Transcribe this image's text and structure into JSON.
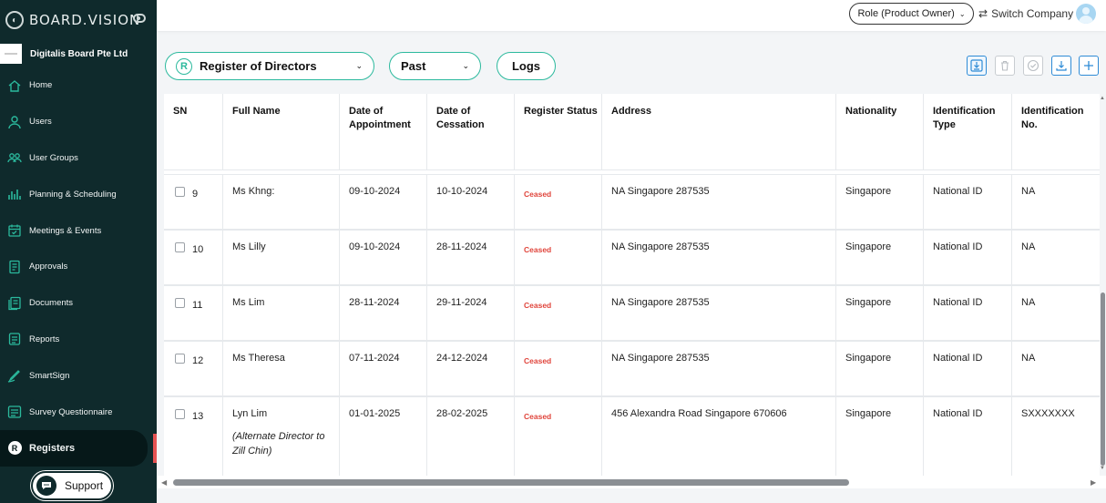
{
  "brand": {
    "name": "BOARD.VISION"
  },
  "company": {
    "name": "Digitalis Board Pte Ltd"
  },
  "nav": [
    {
      "label": "Home",
      "icon": "home-icon"
    },
    {
      "label": "Users",
      "icon": "user-icon"
    },
    {
      "label": "User Groups",
      "icon": "user-group-icon"
    },
    {
      "label": "Planning & Scheduling",
      "icon": "chart-bars-icon"
    },
    {
      "label": "Meetings & Events",
      "icon": "calendar-icon"
    },
    {
      "label": "Approvals",
      "icon": "approval-doc-icon"
    },
    {
      "label": "Documents",
      "icon": "documents-icon"
    },
    {
      "label": "Reports",
      "icon": "report-icon"
    },
    {
      "label": "SmartSign",
      "icon": "pen-icon"
    },
    {
      "label": "Survey Questionnaire",
      "icon": "survey-icon"
    },
    {
      "label": "Registers",
      "icon": "registers-icon",
      "badge": "R",
      "active": true
    }
  ],
  "support": {
    "label": "Support"
  },
  "topbar": {
    "role": "Role (Product Owner)",
    "switch_label": "Switch Company"
  },
  "toolbar": {
    "register_badge": "R",
    "register_select": "Register of Directors",
    "period_select": "Past",
    "logs_label": "Logs"
  },
  "colors": {
    "sidebar": "#0f2a2c",
    "accent": "#2bb99d",
    "ceased": "#e0453c",
    "tool_blue": "#2e8bd6"
  },
  "table": {
    "headers": {
      "sn": "SN",
      "full_name": "Full Name",
      "appointment": "Date of Appointment",
      "cessation": "Date of Cessation",
      "status": "Register Status",
      "address": "Address",
      "nationality": "Nationality",
      "id_type": "Identification Type",
      "id_no": "Identification No."
    },
    "rows": [
      {
        "sn": "9",
        "name": "Ms Khng:",
        "note": "",
        "appointment": "09-10-2024",
        "cessation": "10-10-2024",
        "status": "Ceased",
        "address": "NA Singapore 287535",
        "nationality": "Singapore",
        "id_type": "National ID",
        "id_no": "NA"
      },
      {
        "sn": "10",
        "name": "Ms Lilly",
        "note": "",
        "appointment": "09-10-2024",
        "cessation": "28-11-2024",
        "status": "Ceased",
        "address": "NA Singapore 287535",
        "nationality": "Singapore",
        "id_type": "National ID",
        "id_no": "NA"
      },
      {
        "sn": "11",
        "name": "Ms  Lim",
        "note": "",
        "appointment": "28-11-2024",
        "cessation": "29-11-2024",
        "status": "Ceased",
        "address": "NA Singapore 287535",
        "nationality": "Singapore",
        "id_type": "National ID",
        "id_no": "NA"
      },
      {
        "sn": "12",
        "name": "Ms Theresa",
        "note": "",
        "appointment": "07-11-2024",
        "cessation": "24-12-2024",
        "status": "Ceased",
        "address": "NA Singapore 287535",
        "nationality": "Singapore",
        "id_type": "National ID",
        "id_no": "NA"
      },
      {
        "sn": "13",
        "name": "Lyn Lim",
        "note": "(Alternate Director to Zill Chin)",
        "appointment": "01-01-2025",
        "cessation": "28-02-2025",
        "status": "Ceased",
        "address": "456 Alexandra Road Singapore 670606",
        "nationality": "Singapore",
        "id_type": "National ID",
        "id_no": "SXXXXXXX"
      }
    ]
  }
}
